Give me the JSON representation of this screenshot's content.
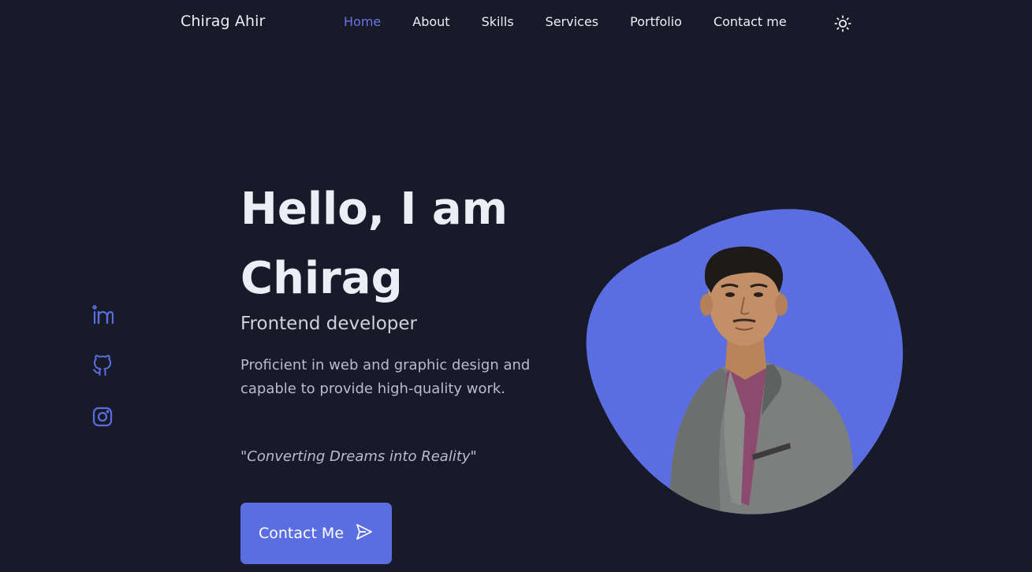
{
  "header": {
    "logo": "Chirag Ahir",
    "nav": [
      {
        "label": "Home",
        "active": true
      },
      {
        "label": "About",
        "active": false
      },
      {
        "label": "Skills",
        "active": false
      },
      {
        "label": "Services",
        "active": false
      },
      {
        "label": "Portfolio",
        "active": false
      },
      {
        "label": "Contact me",
        "active": false
      }
    ],
    "theme_icon": "sun-icon"
  },
  "social": [
    {
      "icon": "linkedin-icon"
    },
    {
      "icon": "github-icon"
    },
    {
      "icon": "instagram-icon"
    }
  ],
  "hero": {
    "title_line1": "Hello, I am",
    "title_line2": "Chirag",
    "subtitle": "Frontend developer",
    "description": "Proficient in web and graphic design and capable to provide high-quality work.",
    "quote": "\"Converting Dreams into Reality\"",
    "cta_label": "Contact Me",
    "cta_icon": "send-icon"
  },
  "colors": {
    "background": "#181a29",
    "accent": "#5b6ee1",
    "nav_active": "#6b74e6",
    "text": "#eceef5"
  }
}
